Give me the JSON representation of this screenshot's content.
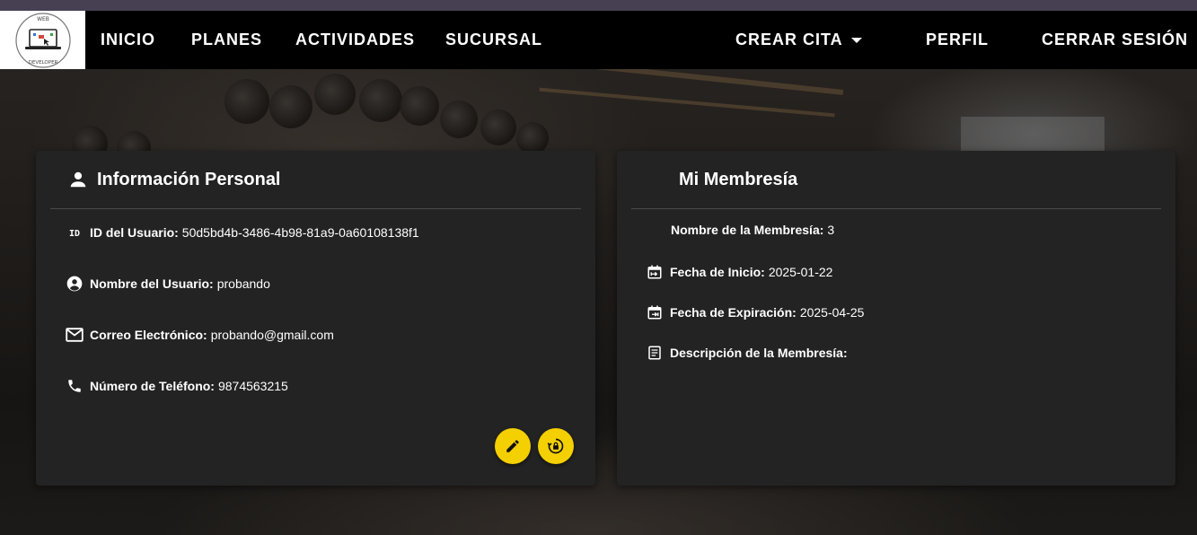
{
  "navbar": {
    "logo_icon": "web-developer-logo",
    "items": [
      {
        "label": "INICIO"
      },
      {
        "label": "PLANES"
      },
      {
        "label": "ACTIVIDADES"
      },
      {
        "label": "SUCURSAL"
      },
      {
        "label": "CREAR CITA"
      },
      {
        "label": "PERFIL"
      },
      {
        "label": "CERRAR SESIÓN"
      }
    ]
  },
  "personal": {
    "title": "Información Personal",
    "rows": [
      {
        "icon": "id-icon",
        "label": "ID del Usuario:",
        "value": "50d5bd4b-3486-4b98-81a9-0a60108138f1"
      },
      {
        "icon": "account-circle-icon",
        "label": "Nombre del Usuario:",
        "value": "probando"
      },
      {
        "icon": "email-icon",
        "label": "Correo Electrónico:",
        "value": "probando@gmail.com"
      },
      {
        "icon": "phone-icon",
        "label": "Número de Teléfono:",
        "value": "9874563215"
      }
    ],
    "actions": [
      "edit-icon",
      "lock-reset-icon"
    ]
  },
  "membership": {
    "title": "Mi Membresía",
    "rows": [
      {
        "label": "Nombre de la Membresía:",
        "value": "3"
      },
      {
        "icon": "calendar-start-icon",
        "label": "Fecha de Inicio:",
        "value": "2025-01-22"
      },
      {
        "icon": "calendar-end-icon",
        "label": "Fecha de Expiración:",
        "value": "2025-04-25"
      },
      {
        "icon": "description-icon",
        "label": "Descripción de la Membresía:",
        "value": ""
      }
    ]
  },
  "colors": {
    "accent": "#f5d000",
    "navbar": "#000000",
    "card": "#232323",
    "topstrip": "#473f52"
  }
}
